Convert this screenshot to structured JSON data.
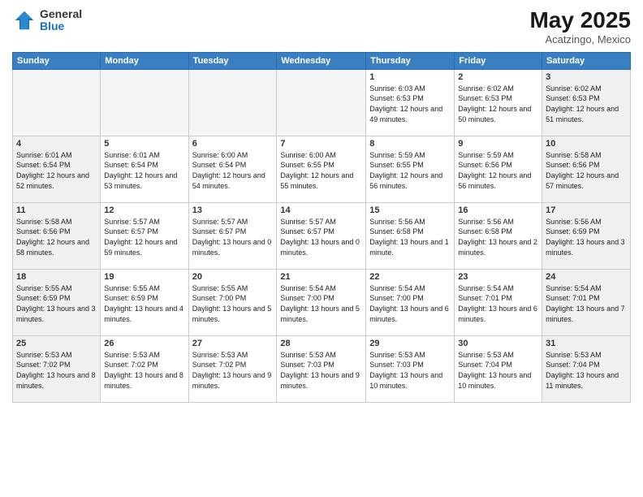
{
  "logo": {
    "general": "General",
    "blue": "Blue"
  },
  "title": "May 2025",
  "location": "Acatzingo, Mexico",
  "weekdays": [
    "Sunday",
    "Monday",
    "Tuesday",
    "Wednesday",
    "Thursday",
    "Friday",
    "Saturday"
  ],
  "weeks": [
    [
      {
        "day": "",
        "info": ""
      },
      {
        "day": "",
        "info": ""
      },
      {
        "day": "",
        "info": ""
      },
      {
        "day": "",
        "info": ""
      },
      {
        "day": "1",
        "info": "Sunrise: 6:03 AM\nSunset: 6:53 PM\nDaylight: 12 hours\nand 49 minutes."
      },
      {
        "day": "2",
        "info": "Sunrise: 6:02 AM\nSunset: 6:53 PM\nDaylight: 12 hours\nand 50 minutes."
      },
      {
        "day": "3",
        "info": "Sunrise: 6:02 AM\nSunset: 6:53 PM\nDaylight: 12 hours\nand 51 minutes."
      }
    ],
    [
      {
        "day": "4",
        "info": "Sunrise: 6:01 AM\nSunset: 6:54 PM\nDaylight: 12 hours\nand 52 minutes."
      },
      {
        "day": "5",
        "info": "Sunrise: 6:01 AM\nSunset: 6:54 PM\nDaylight: 12 hours\nand 53 minutes."
      },
      {
        "day": "6",
        "info": "Sunrise: 6:00 AM\nSunset: 6:54 PM\nDaylight: 12 hours\nand 54 minutes."
      },
      {
        "day": "7",
        "info": "Sunrise: 6:00 AM\nSunset: 6:55 PM\nDaylight: 12 hours\nand 55 minutes."
      },
      {
        "day": "8",
        "info": "Sunrise: 5:59 AM\nSunset: 6:55 PM\nDaylight: 12 hours\nand 56 minutes."
      },
      {
        "day": "9",
        "info": "Sunrise: 5:59 AM\nSunset: 6:56 PM\nDaylight: 12 hours\nand 56 minutes."
      },
      {
        "day": "10",
        "info": "Sunrise: 5:58 AM\nSunset: 6:56 PM\nDaylight: 12 hours\nand 57 minutes."
      }
    ],
    [
      {
        "day": "11",
        "info": "Sunrise: 5:58 AM\nSunset: 6:56 PM\nDaylight: 12 hours\nand 58 minutes."
      },
      {
        "day": "12",
        "info": "Sunrise: 5:57 AM\nSunset: 6:57 PM\nDaylight: 12 hours\nand 59 minutes."
      },
      {
        "day": "13",
        "info": "Sunrise: 5:57 AM\nSunset: 6:57 PM\nDaylight: 13 hours\nand 0 minutes."
      },
      {
        "day": "14",
        "info": "Sunrise: 5:57 AM\nSunset: 6:57 PM\nDaylight: 13 hours\nand 0 minutes."
      },
      {
        "day": "15",
        "info": "Sunrise: 5:56 AM\nSunset: 6:58 PM\nDaylight: 13 hours\nand 1 minute."
      },
      {
        "day": "16",
        "info": "Sunrise: 5:56 AM\nSunset: 6:58 PM\nDaylight: 13 hours\nand 2 minutes."
      },
      {
        "day": "17",
        "info": "Sunrise: 5:56 AM\nSunset: 6:59 PM\nDaylight: 13 hours\nand 3 minutes."
      }
    ],
    [
      {
        "day": "18",
        "info": "Sunrise: 5:55 AM\nSunset: 6:59 PM\nDaylight: 13 hours\nand 3 minutes."
      },
      {
        "day": "19",
        "info": "Sunrise: 5:55 AM\nSunset: 6:59 PM\nDaylight: 13 hours\nand 4 minutes."
      },
      {
        "day": "20",
        "info": "Sunrise: 5:55 AM\nSunset: 7:00 PM\nDaylight: 13 hours\nand 5 minutes."
      },
      {
        "day": "21",
        "info": "Sunrise: 5:54 AM\nSunset: 7:00 PM\nDaylight: 13 hours\nand 5 minutes."
      },
      {
        "day": "22",
        "info": "Sunrise: 5:54 AM\nSunset: 7:00 PM\nDaylight: 13 hours\nand 6 minutes."
      },
      {
        "day": "23",
        "info": "Sunrise: 5:54 AM\nSunset: 7:01 PM\nDaylight: 13 hours\nand 6 minutes."
      },
      {
        "day": "24",
        "info": "Sunrise: 5:54 AM\nSunset: 7:01 PM\nDaylight: 13 hours\nand 7 minutes."
      }
    ],
    [
      {
        "day": "25",
        "info": "Sunrise: 5:53 AM\nSunset: 7:02 PM\nDaylight: 13 hours\nand 8 minutes."
      },
      {
        "day": "26",
        "info": "Sunrise: 5:53 AM\nSunset: 7:02 PM\nDaylight: 13 hours\nand 8 minutes."
      },
      {
        "day": "27",
        "info": "Sunrise: 5:53 AM\nSunset: 7:02 PM\nDaylight: 13 hours\nand 9 minutes."
      },
      {
        "day": "28",
        "info": "Sunrise: 5:53 AM\nSunset: 7:03 PM\nDaylight: 13 hours\nand 9 minutes."
      },
      {
        "day": "29",
        "info": "Sunrise: 5:53 AM\nSunset: 7:03 PM\nDaylight: 13 hours\nand 10 minutes."
      },
      {
        "day": "30",
        "info": "Sunrise: 5:53 AM\nSunset: 7:04 PM\nDaylight: 13 hours\nand 10 minutes."
      },
      {
        "day": "31",
        "info": "Sunrise: 5:53 AM\nSunset: 7:04 PM\nDaylight: 13 hours\nand 11 minutes."
      }
    ]
  ]
}
